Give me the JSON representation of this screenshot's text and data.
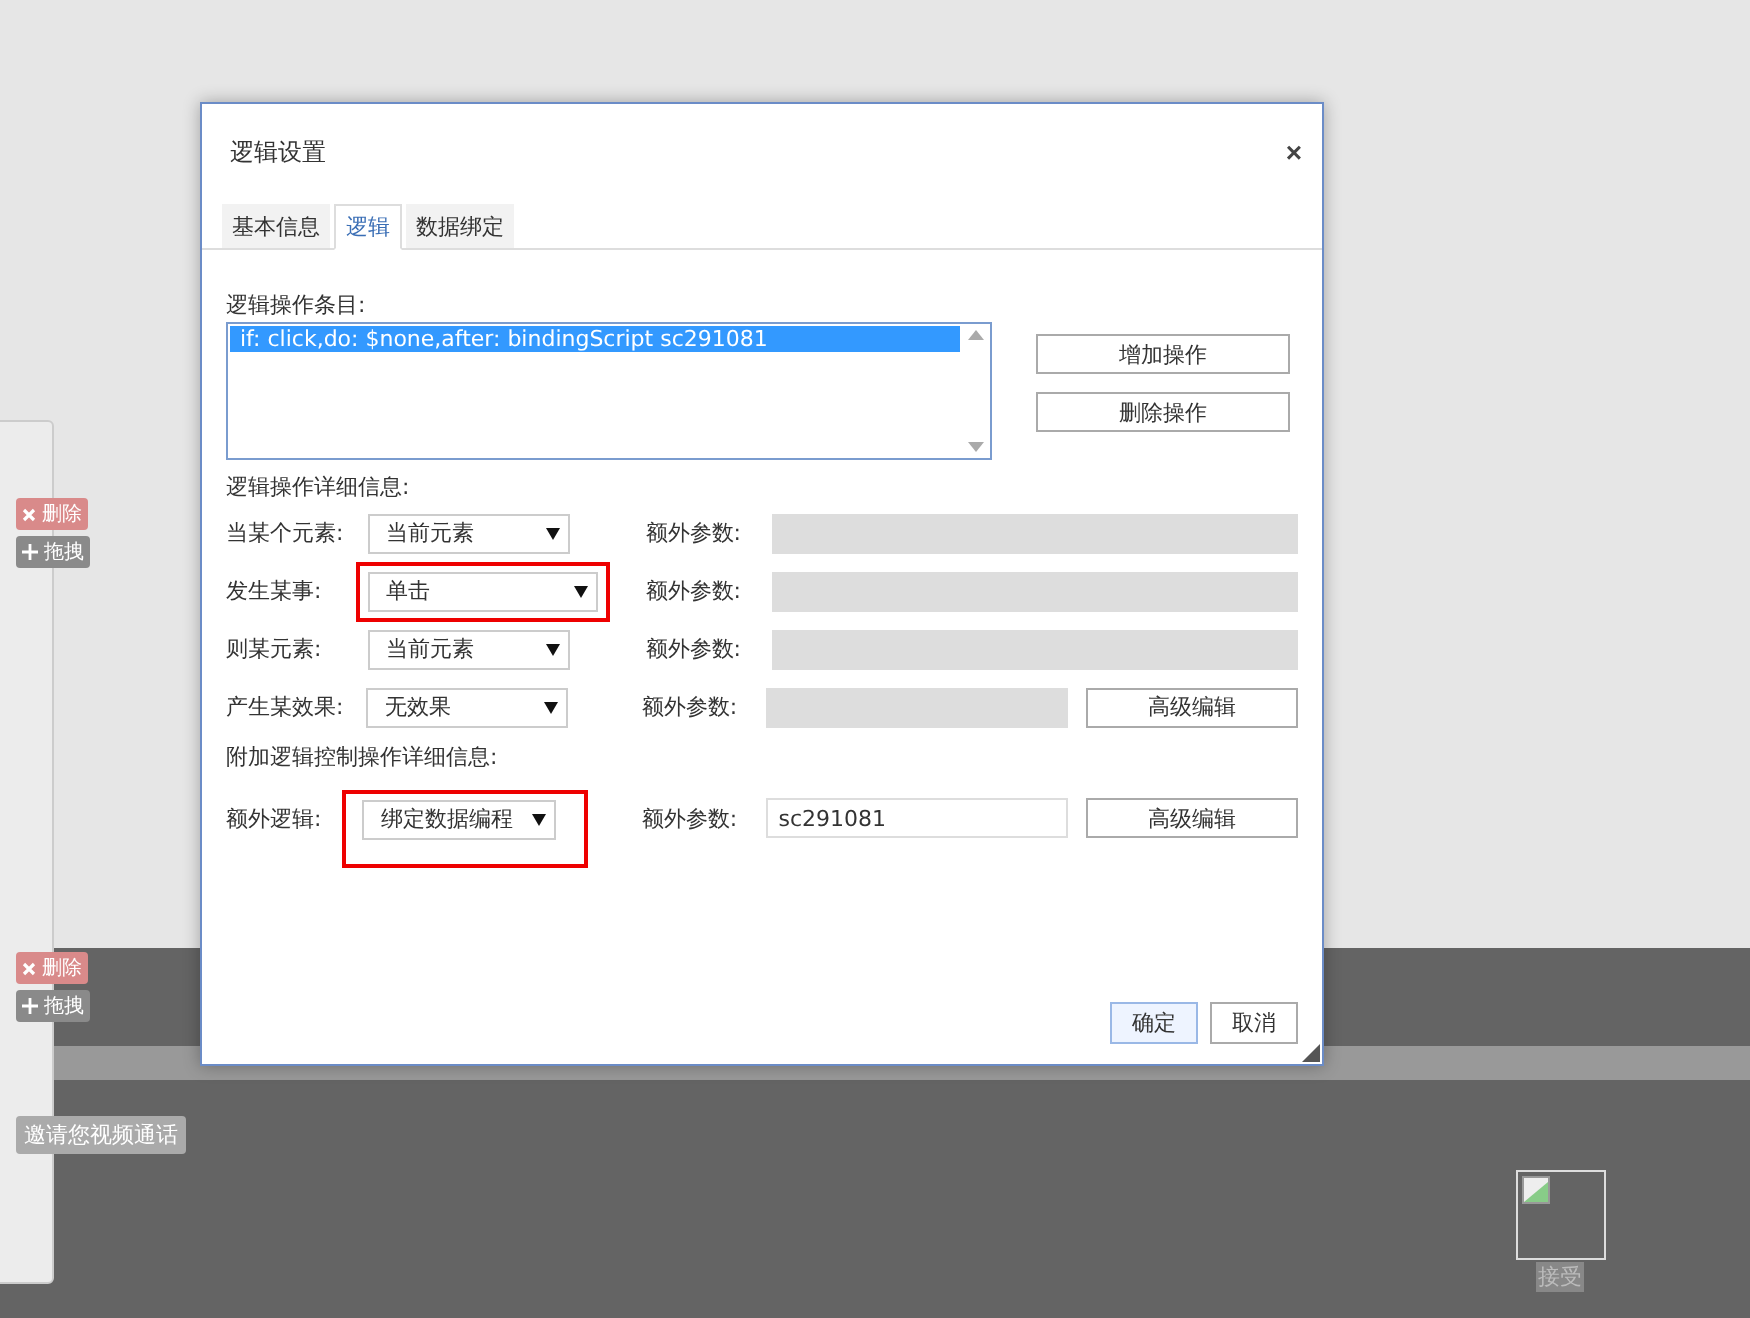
{
  "background": {
    "tool_groups": [
      {
        "delete": "删除",
        "drag": "拖拽"
      },
      {
        "delete": "删除",
        "drag": "拖拽"
      }
    ],
    "invite_badge": "邀请您视频通话",
    "accept_label": "接受"
  },
  "dialog": {
    "title": "逻辑设置",
    "close": "×",
    "tabs": [
      {
        "label": "基本信息",
        "selected": false
      },
      {
        "label": "逻辑",
        "selected": true
      },
      {
        "label": "数据绑定",
        "selected": false
      }
    ],
    "operations_label": "逻辑操作条目:",
    "operations": [
      {
        "text": "if: click,do: $none,after: bindingScript sc291081",
        "selected": true
      }
    ],
    "operation_buttons": [
      "增加操作",
      "删除操作"
    ],
    "detail_label": "逻辑操作详细信息:",
    "detail_rows": [
      {
        "label": "当某个元素:",
        "value": "当前元素",
        "highlighted": false,
        "param_label": "额外参数:",
        "param_value": "",
        "param_disabled": true,
        "button": ""
      },
      {
        "label": "发生某事:",
        "value": "单击",
        "highlighted": true,
        "param_label": "额外参数:",
        "param_value": "",
        "param_disabled": true,
        "button": ""
      },
      {
        "label": "则某元素:",
        "value": "当前元素",
        "highlighted": false,
        "param_label": "额外参数:",
        "param_value": "",
        "param_disabled": true,
        "button": ""
      },
      {
        "label": "产生某效果:",
        "value": "无效果",
        "highlighted": false,
        "param_label": "额外参数:",
        "param_value": "",
        "param_disabled": true,
        "button": "高级编辑"
      }
    ],
    "extra_label": "附加逻辑控制操作详细信息:",
    "extra_rows": [
      {
        "label": "额外逻辑:",
        "value": "绑定数据编程",
        "highlighted": true,
        "param_label": "额外参数:",
        "param_value": "sc291081",
        "param_disabled": false,
        "button": "高级编辑"
      }
    ],
    "footer_buttons": [
      {
        "label": "确定",
        "primary": true
      },
      {
        "label": "取消",
        "primary": false
      }
    ]
  }
}
